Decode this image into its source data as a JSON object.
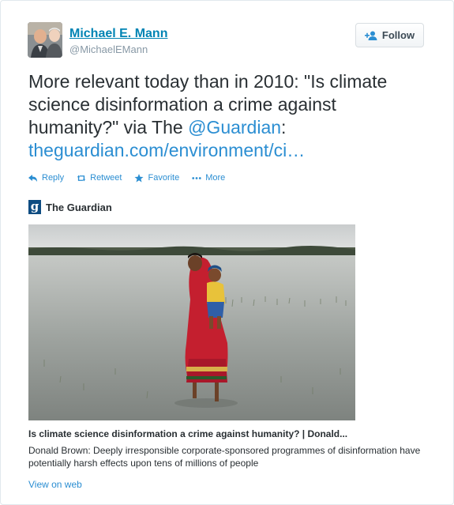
{
  "user": {
    "name": "Michael E. Mann",
    "handle": "@MichaelEMann"
  },
  "follow_label": "Follow",
  "tweet": {
    "text_before": "More relevant today than in 2010: \"Is climate science disinformation a crime against humanity?\" via The ",
    "mention": "@Guardian",
    "text_after": ": ",
    "link": "theguardian.com/environment/ci…"
  },
  "actions": [
    {
      "label": "Reply",
      "icon": "reply-icon"
    },
    {
      "label": "Retweet",
      "icon": "retweet-icon"
    },
    {
      "label": "Favorite",
      "icon": "star-icon"
    },
    {
      "label": "More",
      "icon": "more-dots-icon"
    }
  ],
  "card": {
    "source_logo": "g",
    "source_name": "The Guardian",
    "title": "Is climate science disinformation a crime against humanity? | Donald...",
    "description": "Donald Brown: Deeply irresponsible corporate-sponsored programmes of disinformation have potentially harsh effects upon tens of millions of people",
    "view_on_web": "View on web"
  },
  "colors": {
    "link": "#2b8ed2",
    "name": "#0084b4",
    "guardian": "#0e4c82"
  }
}
